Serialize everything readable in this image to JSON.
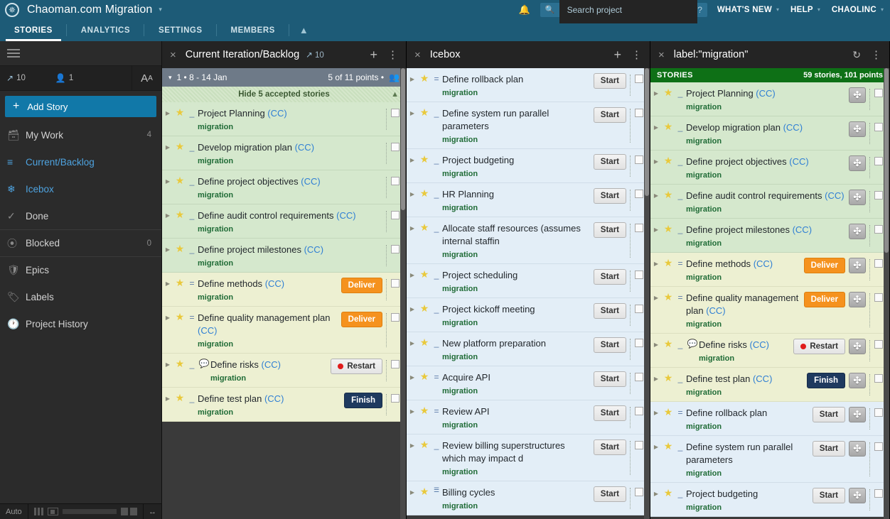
{
  "topbar": {
    "logo_icon": "asterisk-logo-icon",
    "project_title": "Chaoman.com Migration",
    "title_caret": "▾",
    "bell_icon": "bell-icon",
    "search": {
      "icon": "search-icon",
      "placeholder": "Search project",
      "help": "?"
    },
    "menu": [
      {
        "label": "WHAT'S NEW",
        "caret": "▾"
      },
      {
        "label": "HELP",
        "caret": "▾"
      },
      {
        "label": "CHAOLINC",
        "caret": "▾"
      }
    ]
  },
  "navtabs": [
    {
      "label": "STORIES",
      "active": true
    },
    {
      "label": "ANALYTICS",
      "active": false
    },
    {
      "label": "SETTINGS",
      "active": false
    },
    {
      "label": "MEMBERS",
      "active": false
    }
  ],
  "navtabs_collapse_icon": "chevron-up-icon",
  "sidebar": {
    "hamburger_icon": "hamburger-icon",
    "stats": {
      "velocity_icon": "velocity-chart-icon",
      "velocity": "10",
      "people_icon": "person-icon",
      "people": "1",
      "text_size_big": "A",
      "text_size_small": "A"
    },
    "add_story": {
      "plus": "+",
      "label": "Add Story"
    },
    "items": [
      {
        "label": "My Work",
        "icon": "inbox-icon",
        "count": "4",
        "active": false
      },
      {
        "label": "Current/Backlog",
        "icon": "list-icon",
        "count": "",
        "active": true
      },
      {
        "label": "Icebox",
        "icon": "snowflake-icon",
        "count": "",
        "active": true
      },
      {
        "label": "Done",
        "icon": "check-icon",
        "count": "",
        "active": false
      },
      {
        "label": "Blocked",
        "icon": "blocked-icon",
        "count": "0",
        "active": false
      },
      {
        "label": "Epics",
        "icon": "shield-icon",
        "count": "",
        "active": false
      },
      {
        "label": "Labels",
        "icon": "tag-icon",
        "count": "",
        "active": false
      },
      {
        "label": "Project History",
        "icon": "clock-icon",
        "count": "",
        "active": false
      }
    ],
    "bottom": {
      "auto_label": "Auto",
      "layout_icon": "panel-layout-icon",
      "resize_icon": "resize-horizontal-icon"
    }
  },
  "panels": [
    {
      "id": "current-backlog",
      "close_icon": "close-icon",
      "title": "Current Iteration/Backlog",
      "velocity_icon": "velocity-chart-icon",
      "velocity": "10",
      "add_icon": "plus-icon",
      "menu_icon": "kebab-menu-icon",
      "iteration": {
        "caret": "▾",
        "label": "1 • 8 - 14 Jan",
        "points": "5 of 11 points •",
        "people_icon": "people-icon"
      },
      "accepted_bar": {
        "label": "Hide 5 accepted stories",
        "collapse_icon": "chevron-up-icon"
      },
      "stories": [
        {
          "title": "Project Planning",
          "cc": "(CC)",
          "label": "migration",
          "estimate": "_",
          "tone": "green",
          "action": "",
          "comment": false
        },
        {
          "title": "Develop migration plan",
          "cc": "(CC)",
          "label": "migration",
          "estimate": "_",
          "tone": "green",
          "action": "",
          "comment": false
        },
        {
          "title": "Define project objectives",
          "cc": "(CC)",
          "label": "migration",
          "estimate": "_",
          "tone": "green",
          "action": "",
          "comment": false
        },
        {
          "title": "Define audit control requirements",
          "cc": "(CC)",
          "label": "migration",
          "estimate": "_",
          "tone": "green",
          "action": "",
          "comment": false
        },
        {
          "title": "Define project milestones",
          "cc": "(CC)",
          "label": "migration",
          "estimate": "_",
          "tone": "green",
          "action": "",
          "comment": false
        },
        {
          "title": "Define methods",
          "cc": "(CC)",
          "label": "migration",
          "estimate": "=",
          "tone": "yellow",
          "action": "Deliver",
          "comment": false
        },
        {
          "title": "Define quality management plan",
          "cc": "(CC)",
          "label": "migration",
          "estimate": "=",
          "tone": "yellow",
          "action": "Deliver",
          "comment": false
        },
        {
          "title": "Define risks",
          "cc": "(CC)",
          "label": "migration",
          "estimate": "_",
          "tone": "yellow",
          "action": "Restart",
          "comment": true
        },
        {
          "title": "Define test plan",
          "cc": "(CC)",
          "label": "migration",
          "estimate": "_",
          "tone": "yellow",
          "action": "Finish",
          "comment": false
        }
      ]
    },
    {
      "id": "icebox",
      "close_icon": "close-icon",
      "title": "Icebox",
      "add_icon": "plus-icon",
      "menu_icon": "kebab-menu-icon",
      "stories": [
        {
          "title": "Define rollback plan",
          "cc": "",
          "label": "migration",
          "estimate": "=",
          "tone": "blue",
          "action": "Start",
          "comment": false
        },
        {
          "title": "Define system run parallel parameters",
          "cc": "",
          "label": "migration",
          "estimate": "_",
          "tone": "blue",
          "action": "Start",
          "comment": false
        },
        {
          "title": "Project budgeting",
          "cc": "",
          "label": "migration",
          "estimate": "_",
          "tone": "blue",
          "action": "Start",
          "comment": false
        },
        {
          "title": "HR Planning",
          "cc": "",
          "label": "migration",
          "estimate": "_",
          "tone": "blue",
          "action": "Start",
          "comment": false
        },
        {
          "title": "Allocate staff resources (assumes internal staffin",
          "cc": "",
          "label": "migration",
          "estimate": "_",
          "tone": "blue",
          "action": "Start",
          "comment": false
        },
        {
          "title": "Project scheduling",
          "cc": "",
          "label": "migration",
          "estimate": "_",
          "tone": "blue",
          "action": "Start",
          "comment": false
        },
        {
          "title": "Project kickoff meeting",
          "cc": "",
          "label": "migration",
          "estimate": "_",
          "tone": "blue",
          "action": "Start",
          "comment": false
        },
        {
          "title": "New platform preparation",
          "cc": "",
          "label": "migration",
          "estimate": "_",
          "tone": "blue",
          "action": "Start",
          "comment": false
        },
        {
          "title": "Acquire API",
          "cc": "",
          "label": "migration",
          "estimate": "=",
          "tone": "blue",
          "action": "Start",
          "comment": false
        },
        {
          "title": "Review API",
          "cc": "",
          "label": "migration",
          "estimate": "=",
          "tone": "blue",
          "action": "Start",
          "comment": false
        },
        {
          "title": "Review billing superstructures which may impact d",
          "cc": "",
          "label": "migration",
          "estimate": "_",
          "tone": "blue",
          "action": "Start",
          "comment": false
        },
        {
          "title": "Billing cycles",
          "cc": "",
          "label": "migration",
          "estimate": "bars",
          "tone": "blue",
          "action": "Start",
          "comment": false
        }
      ]
    },
    {
      "id": "label-migration",
      "close_icon": "close-icon",
      "title": "label:\"migration\"",
      "refresh_icon": "refresh-icon",
      "menu_icon": "kebab-menu-icon",
      "stories_header": {
        "label": "STORIES",
        "count": "59 stories, 101 points"
      },
      "stories": [
        {
          "title": "Project Planning",
          "cc": "(CC)",
          "label": "migration",
          "estimate": "_",
          "tone": "green",
          "action": "",
          "target": true,
          "comment": false
        },
        {
          "title": "Develop migration plan",
          "cc": "(CC)",
          "label": "migration",
          "estimate": "_",
          "tone": "green",
          "action": "",
          "target": true,
          "comment": false
        },
        {
          "title": "Define project objectives",
          "cc": "(CC)",
          "label": "migration",
          "estimate": "_",
          "tone": "green",
          "action": "",
          "target": true,
          "comment": false
        },
        {
          "title": "Define audit control requirements",
          "cc": "(CC)",
          "label": "migration",
          "estimate": "_",
          "tone": "green",
          "action": "",
          "target": true,
          "comment": false
        },
        {
          "title": "Define project milestones",
          "cc": "(CC)",
          "label": "migration",
          "estimate": "_",
          "tone": "green",
          "action": "",
          "target": true,
          "comment": false
        },
        {
          "title": "Define methods",
          "cc": "(CC)",
          "label": "migration",
          "estimate": "=",
          "tone": "yellow",
          "action": "Deliver",
          "target": true,
          "comment": false
        },
        {
          "title": "Define quality management plan",
          "cc": "(CC)",
          "label": "migration",
          "estimate": "=",
          "tone": "yellow",
          "action": "Deliver",
          "target": true,
          "comment": false
        },
        {
          "title": "Define risks",
          "cc": "(CC)",
          "label": "migration",
          "estimate": "_",
          "tone": "yellow",
          "action": "Restart",
          "target": true,
          "comment": true
        },
        {
          "title": "Define test plan",
          "cc": "(CC)",
          "label": "migration",
          "estimate": "_",
          "tone": "yellow",
          "action": "Finish",
          "target": true,
          "comment": false
        },
        {
          "title": "Define rollback plan",
          "cc": "",
          "label": "migration",
          "estimate": "=",
          "tone": "blue",
          "action": "Start",
          "target": true,
          "comment": false
        },
        {
          "title": "Define system run parallel parameters",
          "cc": "",
          "label": "migration",
          "estimate": "_",
          "tone": "blue",
          "action": "Start",
          "target": true,
          "comment": false
        },
        {
          "title": "Project budgeting",
          "cc": "",
          "label": "migration",
          "estimate": "_",
          "tone": "blue",
          "action": "Start",
          "target": true,
          "comment": false
        }
      ]
    }
  ],
  "colors": {
    "brand_blue": "#1d5b77",
    "accent_button": "#1178a8",
    "accepted_green": "#d5e8cd",
    "started_yellow": "#edf0d2",
    "icebox_blue": "#e3eef7",
    "deliver_orange": "#f5921e",
    "finish_navy": "#1f3a5f",
    "restart_red": "#e01b1b",
    "stories_header_green": "#0e7016"
  }
}
